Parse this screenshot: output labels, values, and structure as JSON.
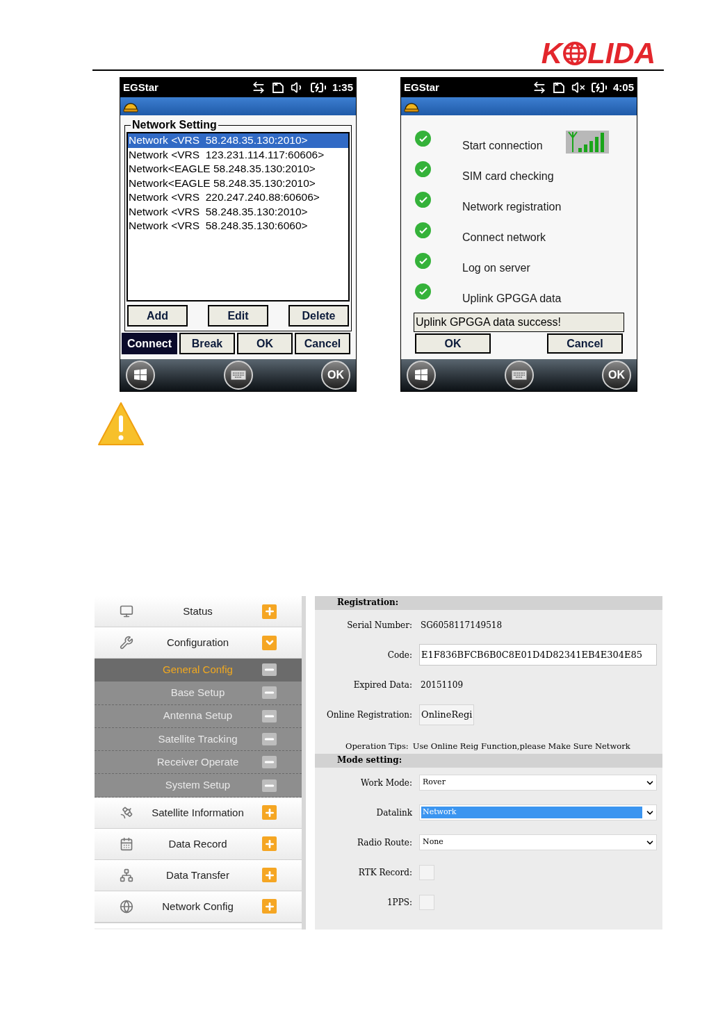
{
  "logo": {
    "left": "K",
    "right": "LIDA"
  },
  "phones": [
    {
      "title": "EGStar",
      "time": "1:35",
      "muted": false,
      "softkey": "OK",
      "kind": "network_list",
      "group_title": "Network Setting",
      "items": [
        {
          "label": "Network <VRS  58.248.35.130:2010>",
          "selected": true
        },
        {
          "label": "Network <VRS  123.231.114.117:60606>",
          "selected": false
        },
        {
          "label": "Network<EAGLE 58.248.35.130:2010>",
          "selected": false
        },
        {
          "label": "Network<EAGLE 58.248.35.130:2010>",
          "selected": false
        },
        {
          "label": "Network <VRS  220.247.240.88:60606>",
          "selected": false
        },
        {
          "label": "Network <VRS  58.248.35.130:2010>",
          "selected": false
        },
        {
          "label": "Network <VRS  58.248.35.130:6060>",
          "selected": false
        }
      ],
      "list_buttons": [
        "Add",
        "Edit",
        "Delete"
      ],
      "buttons": [
        {
          "label": "Connect",
          "selected": true
        },
        {
          "label": "Break",
          "selected": false
        },
        {
          "label": "OK",
          "selected": false
        },
        {
          "label": "Cancel",
          "selected": false
        }
      ]
    },
    {
      "title": "EGStar",
      "time": "4:05",
      "muted": true,
      "softkey": "OK",
      "kind": "connection_steps",
      "steps": [
        {
          "label": "Start connection",
          "done": true
        },
        {
          "label": "SIM card checking",
          "done": true
        },
        {
          "label": "Network registration",
          "done": true
        },
        {
          "label": "Connect network",
          "done": true
        },
        {
          "label": "Log on server",
          "done": true
        },
        {
          "label": "Uplink GPGGA data",
          "done": true
        }
      ],
      "message": "Uplink GPGGA data success!",
      "buttons": [
        {
          "label": "OK",
          "selected": false
        },
        {
          "label": "Cancel",
          "selected": false
        }
      ]
    }
  ],
  "sidebar": {
    "items": [
      {
        "kind": "main",
        "label": "Status",
        "expanded": false
      },
      {
        "kind": "main",
        "label": "Configuration",
        "expanded": true
      },
      {
        "kind": "sub",
        "label": "General Config",
        "selected": true
      },
      {
        "kind": "sub",
        "label": "Base Setup",
        "selected": false
      },
      {
        "kind": "sub",
        "label": "Antenna Setup",
        "selected": false
      },
      {
        "kind": "sub",
        "label": "Satellite Tracking",
        "selected": false
      },
      {
        "kind": "sub",
        "label": "Receiver Operate",
        "selected": false
      },
      {
        "kind": "sub",
        "label": "System Setup",
        "selected": false
      },
      {
        "kind": "main",
        "label": "Satellite Information",
        "expanded": false
      },
      {
        "kind": "main",
        "label": "Data Record",
        "expanded": false
      },
      {
        "kind": "main",
        "label": "Data Transfer",
        "expanded": false
      },
      {
        "kind": "main",
        "label": "Network Config",
        "expanded": false
      }
    ]
  },
  "settings": {
    "sections": [
      {
        "title": "Registration:",
        "rows": [
          {
            "kind": "text",
            "label": "Serial Number:",
            "value": "SG6058117149518"
          },
          {
            "kind": "input",
            "label": "Code:",
            "value": "E1F836BFCB6B0C8E01D4D82341EB4E304E85"
          },
          {
            "kind": "text",
            "label": "Expired Data:",
            "value": "20151109"
          },
          {
            "kind": "button",
            "label": "Online Registration:",
            "value": "OnlineRegi"
          },
          {
            "kind": "tips",
            "label": "Operation Tips:",
            "value": "Use Online Reig Function,please Make Sure Network"
          }
        ]
      },
      {
        "title": "Mode setting:",
        "rows": [
          {
            "kind": "select",
            "label": "Work Mode:",
            "value": "Rover",
            "selected": false
          },
          {
            "kind": "select",
            "label": "Datalink",
            "value": "Network",
            "selected": true
          },
          {
            "kind": "select",
            "label": "Radio Route:",
            "value": "None",
            "selected": false
          },
          {
            "kind": "checkbox",
            "label": "RTK Record:",
            "checked": false
          },
          {
            "kind": "checkbox",
            "label": "1PPS:",
            "checked": false
          }
        ]
      }
    ]
  }
}
